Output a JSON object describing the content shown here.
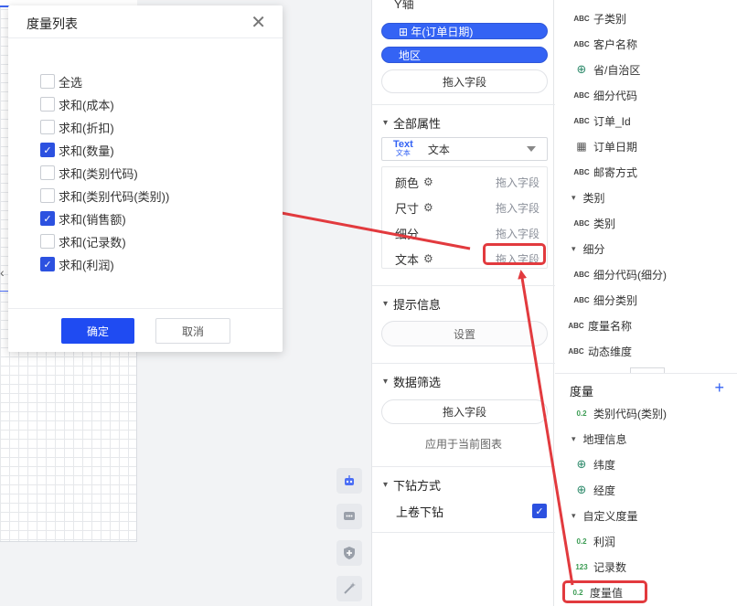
{
  "dialog": {
    "title": "度量列表",
    "select_all": "全选",
    "options": [
      {
        "label": "求和(成本)",
        "checked": false
      },
      {
        "label": "求和(折扣)",
        "checked": false
      },
      {
        "label": "求和(数量)",
        "checked": true
      },
      {
        "label": "求和(类别代码)",
        "checked": false
      },
      {
        "label": "求和(类别代码(类别))",
        "checked": false
      },
      {
        "label": "求和(销售额)",
        "checked": true
      },
      {
        "label": "求和(记录数)",
        "checked": false
      },
      {
        "label": "求和(利润)",
        "checked": true
      }
    ],
    "ok_label": "确定",
    "cancel_label": "取消"
  },
  "config": {
    "y_axis_title": "Y轴",
    "y_pills": [
      "⊞ 年(订单日期)",
      "地区"
    ],
    "drag_field": "拖入字段",
    "all_props_title": "全部属性",
    "mark_type": {
      "icon_top": "Text",
      "icon_bottom": "文本",
      "label": "文本"
    },
    "props": [
      {
        "label": "颜色",
        "drag": "拖入字段"
      },
      {
        "label": "尺寸",
        "drag": "拖入字段"
      },
      {
        "label": "细分",
        "drag": "拖入字段"
      },
      {
        "label": "文本",
        "drag": "拖入字段"
      }
    ],
    "tooltip_title": "提示信息",
    "tooltip_btn": "设置",
    "filter_title": "数据筛选",
    "filter_drag": "拖入字段",
    "filter_apply": "应用于当前图表",
    "drill_title": "下钻方式",
    "drill_option": "上卷下钻",
    "drill_checked": true
  },
  "fields": {
    "dimensions": [
      {
        "type": "ABC",
        "label": "子类别"
      },
      {
        "type": "ABC",
        "label": "客户名称"
      },
      {
        "type": "globe",
        "label": "省/自治区"
      },
      {
        "type": "ABC",
        "label": "细分代码"
      },
      {
        "type": "ABC",
        "label": "订单_Id"
      },
      {
        "type": "calendar",
        "label": "订单日期"
      },
      {
        "type": "ABC",
        "label": "邮寄方式"
      },
      {
        "type": "group",
        "label": "类别"
      },
      {
        "type": "ABC",
        "label": "类别"
      },
      {
        "type": "group",
        "label": "细分"
      },
      {
        "type": "ABC",
        "label": "细分代码(细分)"
      },
      {
        "type": "ABC",
        "label": "细分类别"
      },
      {
        "type": "ABC",
        "label": "度量名称"
      },
      {
        "type": "ABC",
        "label": "动态维度"
      }
    ],
    "measures_title": "度量",
    "measures": [
      {
        "type": "0.2",
        "label": "类别代码(类别)"
      },
      {
        "type": "group",
        "label": "地理信息"
      },
      {
        "type": "globe",
        "label": "纬度"
      },
      {
        "type": "globe",
        "label": "经度"
      },
      {
        "type": "group",
        "label": "自定义度量"
      },
      {
        "type": "0.2",
        "label": "利润"
      },
      {
        "type": "123",
        "label": "记录数"
      },
      {
        "type": "0.2",
        "label": "度量值"
      }
    ]
  },
  "colors": {
    "accent": "#2c51e0",
    "highlight": "#e23a3e"
  }
}
